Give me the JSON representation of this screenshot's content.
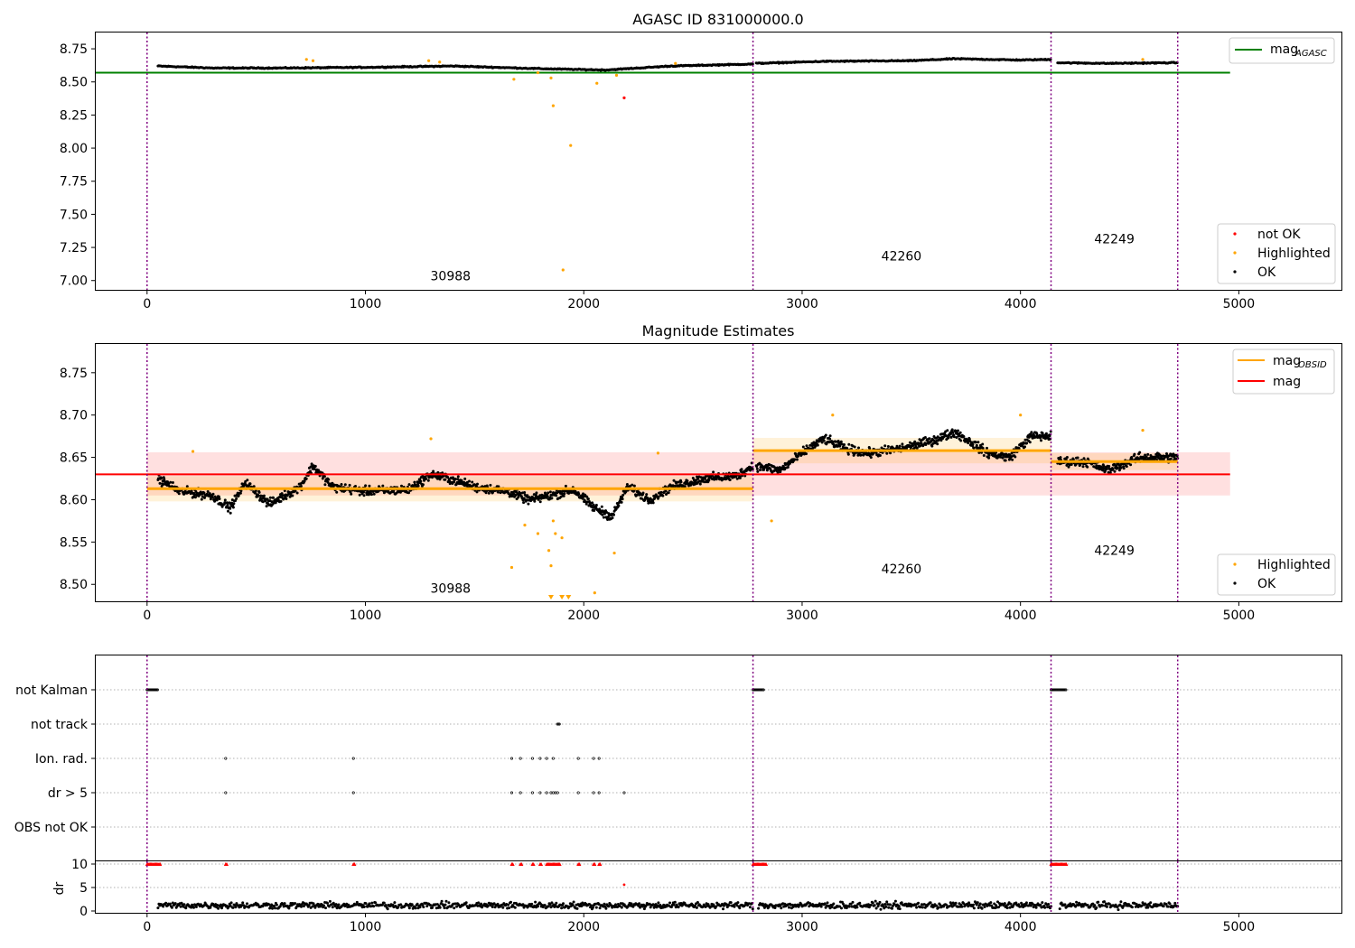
{
  "chart_data": [
    {
      "type": "scatter",
      "title": "AGASC ID 831000000.0",
      "xlabel": "",
      "ylabel": "",
      "xlim": [
        -235,
        5470
      ],
      "ylim": [
        6.93,
        8.88
      ],
      "xticks": [
        0,
        1000,
        2000,
        3000,
        4000,
        5000
      ],
      "yticks": [
        7.0,
        7.25,
        7.5,
        7.75,
        8.0,
        8.25,
        8.5,
        8.75
      ],
      "ytick_labels": [
        "7.00",
        "7.25",
        "7.50",
        "7.75",
        "8.00",
        "8.25",
        "8.50",
        "8.75"
      ],
      "obsid_boundaries": [
        0,
        2775,
        4140,
        4720
      ],
      "obsid_labels": [
        {
          "text": "30988",
          "x": 1390,
          "y": 7.0
        },
        {
          "text": "42260",
          "x": 3455,
          "y": 7.15
        },
        {
          "text": "42249",
          "x": 4430,
          "y": 7.28
        }
      ],
      "reference_lines": [
        {
          "name": "mag_AGASC",
          "y": 8.57,
          "x_range": [
            -235,
            4960
          ],
          "color": "#008000"
        }
      ],
      "outliers_highlighted": [
        [
          1680,
          8.52
        ],
        [
          1790,
          8.57
        ],
        [
          1850,
          8.53
        ],
        [
          1860,
          8.32
        ],
        [
          1905,
          7.08
        ],
        [
          1940,
          8.02
        ],
        [
          2060,
          8.49
        ],
        [
          2150,
          8.55
        ],
        [
          730,
          8.67
        ],
        [
          760,
          8.66
        ],
        [
          1290,
          8.66
        ],
        [
          1340,
          8.65
        ],
        [
          2420,
          8.64
        ],
        [
          4560,
          8.67
        ]
      ],
      "outliers_not_ok": [
        [
          2185,
          8.38
        ]
      ],
      "segments": [
        {
          "x_range": [
            50,
            2775
          ],
          "trend": [
            [
              50,
              8.62
            ],
            [
              300,
              8.605
            ],
            [
              600,
              8.605
            ],
            [
              1000,
              8.61
            ],
            [
              1400,
              8.62
            ],
            [
              1800,
              8.6
            ],
            [
              2100,
              8.59
            ],
            [
              2400,
              8.62
            ],
            [
              2775,
              8.635
            ]
          ]
        },
        {
          "x_range": [
            2790,
            4140
          ],
          "trend": [
            [
              2790,
              8.64
            ],
            [
              3100,
              8.655
            ],
            [
              3500,
              8.66
            ],
            [
              3700,
              8.675
            ],
            [
              4000,
              8.665
            ],
            [
              4140,
              8.67
            ]
          ]
        },
        {
          "x_range": [
            4170,
            4720
          ],
          "trend": [
            [
              4170,
              8.645
            ],
            [
              4400,
              8.64
            ],
            [
              4720,
              8.645
            ]
          ]
        }
      ],
      "legend": {
        "placement": "top-right",
        "entries": [
          {
            "label": "mag",
            "sub": "AGASC",
            "color": "#008000"
          }
        ]
      },
      "legend2": {
        "placement": "lower-right",
        "entries": [
          {
            "label": "not OK",
            "color": "#ff0000"
          },
          {
            "label": "Highlighted",
            "color": "#ffa500"
          },
          {
            "label": "OK",
            "color": "#000000"
          }
        ]
      }
    },
    {
      "type": "scatter",
      "title": "Magnitude Estimates",
      "xlabel": "",
      "ylabel": "",
      "xlim": [
        -235,
        5470
      ],
      "ylim": [
        8.48,
        8.785
      ],
      "xticks": [
        0,
        1000,
        2000,
        3000,
        4000,
        5000
      ],
      "yticks": [
        8.5,
        8.55,
        8.6,
        8.65,
        8.7,
        8.75
      ],
      "ytick_labels": [
        "8.50",
        "8.55",
        "8.60",
        "8.65",
        "8.70",
        "8.75"
      ],
      "obsid_boundaries": [
        0,
        2775,
        4140,
        4720
      ],
      "obsid_labels": [
        {
          "text": "30988",
          "x": 1390,
          "y": 8.49
        },
        {
          "text": "42260",
          "x": 3455,
          "y": 8.513
        },
        {
          "text": "42249",
          "x": 4430,
          "y": 8.535
        }
      ],
      "mag": {
        "value": 8.63,
        "band": [
          8.605,
          8.656
        ],
        "x_range": [
          0,
          4960
        ],
        "color": "#ff0000"
      },
      "mag_obsid": [
        {
          "obsid": "30988",
          "x_range": [
            0,
            2775
          ],
          "value": 8.613,
          "band": [
            8.598,
            8.628
          ]
        },
        {
          "obsid": "42260",
          "x_range": [
            2775,
            4140
          ],
          "value": 8.658,
          "band": [
            8.643,
            8.673
          ]
        },
        {
          "obsid": "42249",
          "x_range": [
            4140,
            4720
          ],
          "value": 8.645,
          "band": [
            8.635,
            8.655
          ]
        }
      ],
      "outliers_highlighted": [
        [
          1670,
          8.52
        ],
        [
          1730,
          8.57
        ],
        [
          1790,
          8.56
        ],
        [
          1840,
          8.54
        ],
        [
          1850,
          8.522
        ],
        [
          1860,
          8.575
        ],
        [
          1870,
          8.56
        ],
        [
          1900,
          8.555
        ],
        [
          2050,
          8.49
        ],
        [
          2140,
          8.537
        ],
        [
          2860,
          8.575
        ],
        [
          3140,
          8.7
        ],
        [
          4000,
          8.7
        ],
        [
          4560,
          8.682
        ],
        [
          210,
          8.657
        ],
        [
          1300,
          8.672
        ],
        [
          2340,
          8.655
        ]
      ],
      "offscale_markers": [
        1850,
        1900,
        1930
      ],
      "segments": [
        {
          "x_range": [
            50,
            2775
          ],
          "trend": [
            [
              50,
              8.625
            ],
            [
              150,
              8.61
            ],
            [
              300,
              8.605
            ],
            [
              380,
              8.59
            ],
            [
              450,
              8.62
            ],
            [
              560,
              8.595
            ],
            [
              700,
              8.615
            ],
            [
              760,
              8.64
            ],
            [
              850,
              8.615
            ],
            [
              1000,
              8.61
            ],
            [
              1200,
              8.612
            ],
            [
              1300,
              8.63
            ],
            [
              1380,
              8.625
            ],
            [
              1500,
              8.615
            ],
            [
              1650,
              8.61
            ],
            [
              1750,
              8.6
            ],
            [
              1850,
              8.605
            ],
            [
              1950,
              8.612
            ],
            [
              2050,
              8.59
            ],
            [
              2130,
              8.58
            ],
            [
              2200,
              8.615
            ],
            [
              2300,
              8.6
            ],
            [
              2400,
              8.615
            ],
            [
              2550,
              8.625
            ],
            [
              2700,
              8.628
            ],
            [
              2775,
              8.64
            ]
          ]
        },
        {
          "x_range": [
            2790,
            4140
          ],
          "trend": [
            [
              2790,
              8.64
            ],
            [
              2900,
              8.635
            ],
            [
              3000,
              8.655
            ],
            [
              3100,
              8.672
            ],
            [
              3200,
              8.66
            ],
            [
              3300,
              8.655
            ],
            [
              3450,
              8.66
            ],
            [
              3600,
              8.67
            ],
            [
              3700,
              8.68
            ],
            [
              3850,
              8.655
            ],
            [
              3950,
              8.65
            ],
            [
              4050,
              8.675
            ],
            [
              4140,
              8.675
            ]
          ]
        },
        {
          "x_range": [
            4170,
            4720
          ],
          "trend": [
            [
              4170,
              8.645
            ],
            [
              4300,
              8.645
            ],
            [
              4400,
              8.635
            ],
            [
              4550,
              8.65
            ],
            [
              4720,
              8.65
            ]
          ]
        }
      ],
      "legend": {
        "placement": "top-right",
        "entries": [
          {
            "label": "mag",
            "sub": "OBSID",
            "color": "#ffa500"
          },
          {
            "label": "mag",
            "color": "#ff0000"
          }
        ]
      },
      "legend2": {
        "placement": "lower-right",
        "entries": [
          {
            "label": "Highlighted",
            "color": "#ffa500"
          },
          {
            "label": "OK",
            "color": "#000000"
          }
        ]
      }
    },
    {
      "type": "scatter",
      "title": "",
      "xlabel": "",
      "ylabel": "",
      "xlim": [
        -235,
        5470
      ],
      "categories": [
        "not Kalman",
        "not track",
        "Ion. rad.",
        "dr > 5",
        "OBS not OK"
      ],
      "flags": {
        "not Kalman": [
          [
            0,
            50
          ],
          [
            2775,
            2825
          ],
          [
            4140,
            4210
          ]
        ],
        "not track": [
          [
            1880,
            1890
          ]
        ],
        "Ion. rad.": [
          360,
          945,
          1670,
          1710,
          1765,
          1800,
          1830,
          1860,
          1975,
          2045,
          2070
        ],
        "dr > 5": [
          360,
          945,
          1670,
          1710,
          1765,
          1800,
          1830,
          1850,
          1860,
          1870,
          1880,
          1975,
          2045,
          2070,
          2185
        ],
        "OBS not OK": []
      },
      "obsid_boundaries": [
        0,
        2775,
        4140,
        4720
      ]
    },
    {
      "type": "scatter",
      "title": "",
      "xlabel": "",
      "ylabel": "dr",
      "xlim": [
        -235,
        5470
      ],
      "ylim": [
        -0.3,
        11
      ],
      "xticks": [
        0,
        1000,
        2000,
        3000,
        4000,
        5000
      ],
      "yticks": [
        0,
        5,
        10
      ],
      "ytick_labels": [
        "0",
        "5",
        "10"
      ],
      "cap_value": 10,
      "over_cap": [
        [
          0,
          60
        ],
        [
          360,
          365
        ],
        [
          945,
          950
        ],
        [
          1670,
          1675
        ],
        [
          1710,
          1715
        ],
        [
          1765,
          1770
        ],
        [
          1800,
          1805
        ],
        [
          1830,
          1890
        ],
        [
          1975,
          1980
        ],
        [
          2045,
          2050
        ],
        [
          2070,
          2075
        ],
        [
          2775,
          2835
        ],
        [
          4140,
          4210
        ]
      ],
      "not_ok_points": [
        [
          2185,
          5.6
        ]
      ],
      "dr_typical": {
        "mean": 1.2,
        "spread": 1.0,
        "x_ranges": [
          [
            50,
            2775
          ],
          [
            2800,
            4140
          ],
          [
            4180,
            4720
          ]
        ]
      },
      "obsid_boundaries": [
        0,
        2775,
        4140,
        4720
      ]
    }
  ]
}
